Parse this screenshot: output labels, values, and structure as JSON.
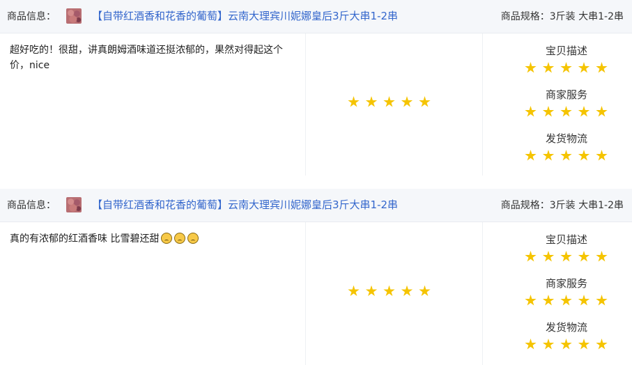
{
  "reviews": [
    {
      "product_info_label": "商品信息：",
      "product_title": "【自带红酒香和花香的葡萄】云南大理宾川妮娜皇后3斤大串1-2串",
      "spec": "商品规格：3斤装 大串1-2串",
      "comment": "超好吃的！很甜，讲真朗姆酒味道还挺浓郁的，果然对得起这个价，nice",
      "emoji_count": 0,
      "overall_rating": 5,
      "metrics": [
        {
          "label": "宝贝描述",
          "rating": 5
        },
        {
          "label": "商家服务",
          "rating": 5
        },
        {
          "label": "发货物流",
          "rating": 5
        }
      ]
    },
    {
      "product_info_label": "商品信息：",
      "product_title": "【自带红酒香和花香的葡萄】云南大理宾川妮娜皇后3斤大串1-2串",
      "spec": "商品规格：3斤装 大串1-2串",
      "comment": "真的有浓郁的红酒香味 比雪碧还甜",
      "emoji_count": 3,
      "emoji_icon": "disappointed-face-emoji",
      "overall_rating": 5,
      "metrics": [
        {
          "label": "宝贝描述",
          "rating": 5
        },
        {
          "label": "商家服务",
          "rating": 5
        },
        {
          "label": "发货物流",
          "rating": 5
        }
      ]
    }
  ],
  "icons": {
    "thumbnail": "grape-product-thumbnail",
    "star": "star-icon"
  },
  "colors": {
    "header_bg": "#f5f7fa",
    "link": "#3366cc",
    "star": "#f5c400"
  }
}
